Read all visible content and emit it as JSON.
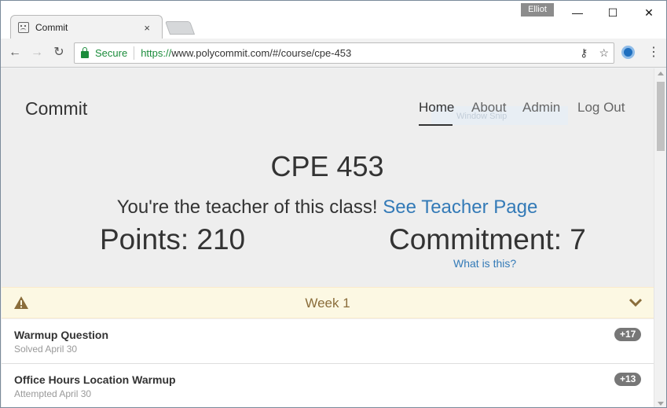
{
  "browser": {
    "tab_title": "Commit",
    "tab_close": "×",
    "user_name": "Elliot",
    "minimize": "—",
    "maximize": "☐",
    "close": "✕",
    "back": "←",
    "forward": "→",
    "reload": "↻",
    "secure_label": "Secure",
    "url_scheme": "https://",
    "url_rest": "www.polycommit.com/#/course/cpe-453",
    "key_icon": "⚷",
    "star_icon": "☆",
    "menu_icon": "⋮"
  },
  "header": {
    "brand": "Commit",
    "nav": [
      "Home",
      "About",
      "Admin",
      "Log Out"
    ],
    "active_nav": "Home",
    "ghost_text": "Window Snip"
  },
  "course": {
    "title": "CPE 453",
    "teacher_text": "You're the teacher of this class!",
    "teacher_link": "See Teacher Page",
    "points": "Points: 210",
    "commitment": "Commitment: 7",
    "what_is_this": "What is this?"
  },
  "week": {
    "title": "Week 1",
    "color": "#8a6d3b",
    "background": "#fcf8e3"
  },
  "items": [
    {
      "title": "Warmup Question",
      "status": "Solved April 30",
      "badge": "+17"
    },
    {
      "title": "Office Hours Location Warmup",
      "status": "Attempted April 30",
      "badge": "+13"
    }
  ],
  "colors": {
    "link": "#337ab7",
    "secure": "#1b8c3b"
  }
}
